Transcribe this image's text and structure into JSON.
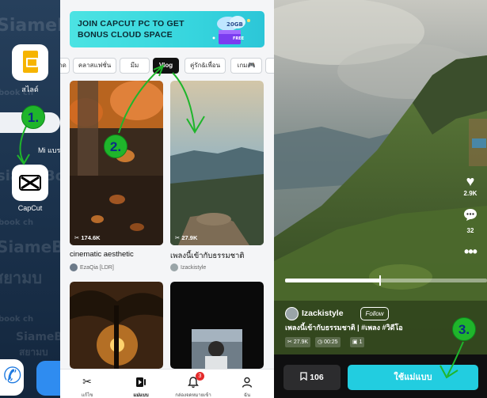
{
  "home": {
    "watermarks": [
      "SiameBoo",
      "book ch",
      "siameBoo",
      "book ch",
      "SiameBoo",
      "สยามบ",
      "book ch",
      "SiameBoo",
      "สยามบ"
    ],
    "apps": [
      {
        "label": "สไลด์",
        "icon": "google-slides-icon",
        "color": "#f6b400"
      },
      {
        "label": "CapCut",
        "icon": "capcut-icon",
        "color": "#000000"
      }
    ],
    "mi_label": "Mi แบร",
    "dock": [
      {
        "icon": "phone-icon",
        "color": "#1f7ae0"
      },
      {
        "icon": "messages-icon",
        "color": "#2f8cf0"
      }
    ]
  },
  "capcut": {
    "banner": {
      "line1": "JOIN CAPCUT PC TO GET",
      "line2": "BONUS CLOUD SPACE",
      "badge": "20GB",
      "box_label": "FREE"
    },
    "tabs": [
      {
        "label": "าด",
        "active": false
      },
      {
        "label": "คลาสแฟชั่น",
        "active": false
      },
      {
        "label": "มีม",
        "active": false
      },
      {
        "label": "Vlog",
        "active": true
      },
      {
        "label": "คู่รัก&เพื่อน",
        "active": false
      },
      {
        "label": "เกม🎮",
        "active": false
      },
      {
        "label": "",
        "active": false
      }
    ],
    "templates": [
      {
        "title": "cinematic aesthetic",
        "uses": "174.6K",
        "author": "EzaQia [LDR]"
      },
      {
        "title": "เพลงนี้เข้ากับธรรมชาติ",
        "uses": "27.9K",
        "author": "Izackistyle"
      },
      {
        "title": "",
        "uses": "",
        "author": ""
      },
      {
        "title": "",
        "uses": "",
        "author": ""
      }
    ],
    "nav": [
      {
        "label": "แก้ไข",
        "icon": "scissors-icon"
      },
      {
        "label": "แม่แบบ",
        "icon": "template-icon",
        "active": true
      },
      {
        "label": "กล่องจดหมายเข้า",
        "icon": "bell-icon",
        "badge": "3"
      },
      {
        "label": "ฉัน",
        "icon": "profile-icon"
      }
    ]
  },
  "preview": {
    "side_actions": [
      {
        "icon": "heart-icon",
        "count": "2.9K"
      },
      {
        "icon": "comment-icon",
        "count": "32"
      },
      {
        "icon": "more-icon",
        "count": ""
      }
    ],
    "progress": 0.47,
    "creator": "Izackistyle",
    "follow_label": "Follow",
    "title": "เพลงนี้เข้ากับธรรมชาติ | #เพลง #วิดีโอ",
    "stats": [
      {
        "icon": "uses-icon",
        "text": "27.9K"
      },
      {
        "icon": "clock-icon",
        "text": "00:25"
      },
      {
        "icon": "clip-icon",
        "text": "1"
      }
    ],
    "save_count": "106",
    "use_label": "ใช้แม่แบบ"
  },
  "annotations": {
    "steps": [
      "1.",
      "2.",
      "3."
    ],
    "color": "#1fb52b"
  }
}
